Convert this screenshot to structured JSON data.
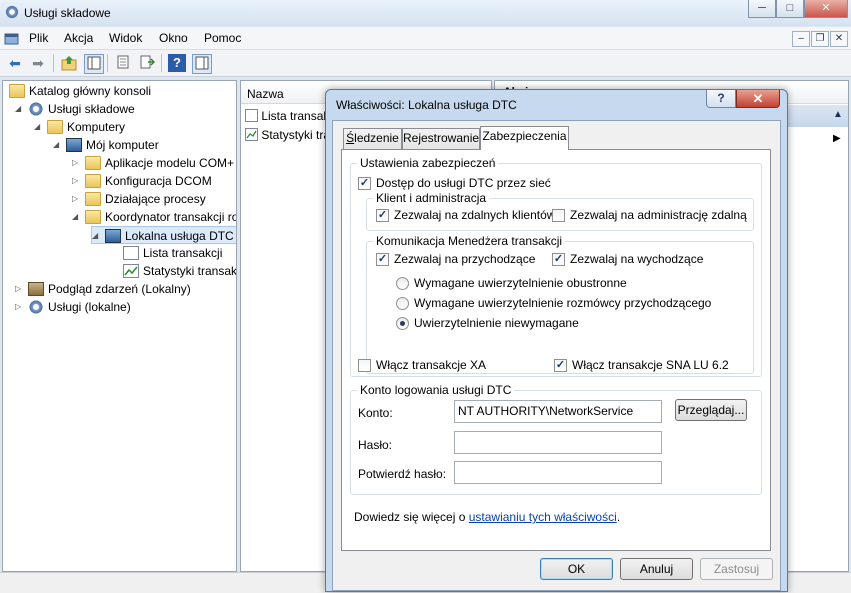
{
  "window": {
    "title": "Usługi składowe",
    "caption_buttons": {
      "minimize": "─",
      "maximize": "□",
      "close": "✕"
    }
  },
  "menu": [
    "Plik",
    "Akcja",
    "Widok",
    "Okno",
    "Pomoc"
  ],
  "mdi_buttons": {
    "minimize": "–",
    "restore": "❐",
    "close": "✕"
  },
  "tree": {
    "items": [
      {
        "label": "Katalog główny konsoli"
      },
      {
        "label": "Usługi składowe"
      },
      {
        "label": "Komputery"
      },
      {
        "label": "Mój komputer"
      },
      {
        "label": "Aplikacje modelu COM+"
      },
      {
        "label": "Konfiguracja DCOM"
      },
      {
        "label": "Działające procesy"
      },
      {
        "label": "Koordynator transakcji rozproszonych"
      },
      {
        "label": "Lokalna usługa DTC"
      },
      {
        "label": "Lista transakcji"
      },
      {
        "label": "Statystyki transakcji"
      },
      {
        "label": "Podgląd zdarzeń (Lokalny)"
      },
      {
        "label": "Usługi (lokalne)"
      }
    ]
  },
  "list": {
    "header": "Nazwa",
    "items": [
      "Lista transakcji",
      "Statystyki transakcji"
    ]
  },
  "actions": {
    "header": "Akcje"
  },
  "dialog": {
    "title": "Właściwości: Lokalna usługa DTC",
    "help_label": "?",
    "close_label": "✕",
    "tabs": [
      "Śledzenie",
      "Rejestrowanie",
      "Zabezpieczenia"
    ],
    "active_tab": "Zabezpieczenia",
    "security_group": {
      "title": "Ustawienia zabezpieczeń",
      "network_access": {
        "label": "Dostęp do usługi DTC przez sieć",
        "checked": true
      },
      "client_admin": {
        "title": "Klient i administracja",
        "remote_clients": {
          "label": "Zezwalaj na zdalnych klientów",
          "checked": true
        },
        "remote_admin": {
          "label": "Zezwalaj na administrację zdalną",
          "checked": false
        }
      },
      "tm_comm": {
        "title": "Komunikacja Menedżera transakcji",
        "inbound": {
          "label": "Zezwalaj na przychodzące",
          "checked": true
        },
        "outbound": {
          "label": "Zezwalaj na wychodzące",
          "checked": true
        },
        "auth_mutual": {
          "label": "Wymagane uwierzytelnienie obustronne",
          "selected": false
        },
        "auth_incoming": {
          "label": "Wymagane uwierzytelnienie rozmówcy przychodzącego",
          "selected": false
        },
        "auth_none": {
          "label": "Uwierzytelnienie niewymagane",
          "selected": true
        }
      },
      "xa": {
        "label": "Włącz transakcje XA",
        "checked": false
      },
      "sna": {
        "label": "Włącz transakcje SNA LU 6.2",
        "checked": true
      }
    },
    "account_group": {
      "title": "Konto logowania usługi DTC",
      "account_label": "Konto:",
      "account_value": "NT AUTHORITY\\NetworkService",
      "browse_label": "Przeglądaj...",
      "password_label": "Hasło:",
      "password_value": "",
      "confirm_label": "Potwierdź hasło:",
      "confirm_value": ""
    },
    "learn_more": {
      "prefix": "Dowiedz się więcej o ",
      "link": "ustawianiu tych właściwości",
      "suffix": "."
    },
    "buttons": {
      "ok": "OK",
      "cancel": "Anuluj",
      "apply": "Zastosuj"
    }
  }
}
